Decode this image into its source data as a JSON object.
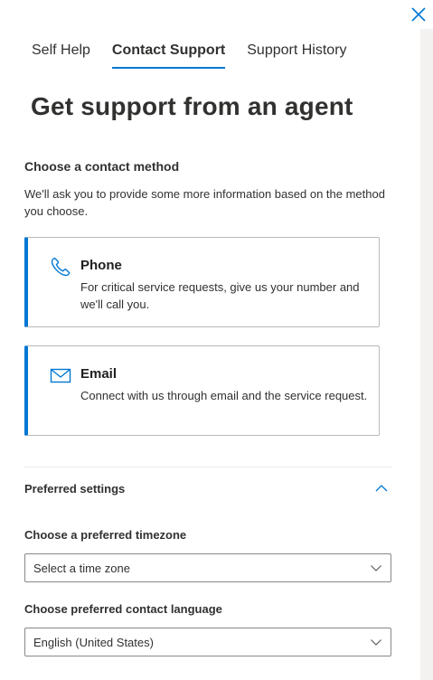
{
  "tabs": [
    {
      "label": "Self Help",
      "active": false
    },
    {
      "label": "Contact Support",
      "active": true
    },
    {
      "label": "Support History",
      "active": false
    }
  ],
  "page_title": "Get support from an agent",
  "contact_section": {
    "heading": "Choose a contact method",
    "description": "We'll ask you to provide some more information based on the method you choose."
  },
  "methods": {
    "phone": {
      "icon": "phone-icon",
      "label": "Phone",
      "description": "For critical service requests, give us your number and we'll call you."
    },
    "email": {
      "icon": "mail-icon",
      "label": "Email",
      "description": "Connect with us through email and the service request."
    }
  },
  "preferred_settings": {
    "heading": "Preferred settings",
    "expanded": true,
    "timezone": {
      "label": "Choose a preferred timezone",
      "value": "Select a time zone"
    },
    "language": {
      "label": "Choose preferred contact language",
      "value": "English (United States)"
    }
  },
  "colors": {
    "accent": "#0078d4",
    "text": "#323130",
    "border": "#8a8886"
  }
}
